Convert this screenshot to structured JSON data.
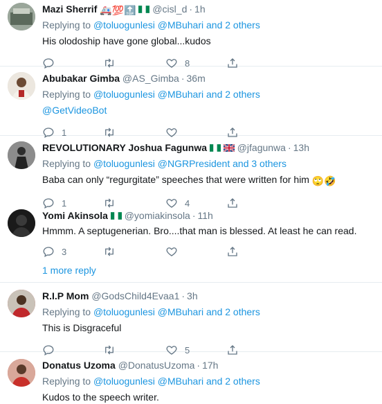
{
  "tweets": [
    {
      "name": "Mazi Sherrif",
      "handle": "@cisl_d",
      "time": "1h",
      "replying_prefix": "Replying to ",
      "mentions": "@toluogunlesi @MBuhari and 2 others",
      "text": "His olodoship have gone global...kudos",
      "reply_count": "",
      "retweet_count": "",
      "like_count": "8"
    },
    {
      "name": "Abubakar Gimba",
      "handle": "@AS_Gimba",
      "time": "36m",
      "replying_prefix": "Replying to ",
      "mentions": "@toluogunlesi @MBuhari and 2 others",
      "text": "@GetVideoBot",
      "reply_count": "1",
      "retweet_count": "",
      "like_count": ""
    },
    {
      "name": "REVOLUTIONARY Joshua Fagunwa",
      "handle": "@jfagunwa",
      "time": "13h",
      "replying_prefix": "Replying to ",
      "mentions": "@toluogunlesi @NGRPresident and 3 others",
      "text": "Baba can only “regurgitate” speeches that were written for him",
      "reply_count": "1",
      "retweet_count": "",
      "like_count": "4"
    },
    {
      "name": "Yomi Akinsola",
      "handle": "@yomiakinsola",
      "time": "11h",
      "replying_prefix": "",
      "mentions": "",
      "text": "Hmmm. A septugenerian. Bro....that man is blessed. At least he can read.",
      "reply_count": "3",
      "retweet_count": "",
      "like_count": ""
    },
    {
      "name": "R.I.P Mom",
      "handle": "@GodsChild4Evaa1",
      "time": "3h",
      "replying_prefix": "Replying to ",
      "mentions": "@toluogunlesi @MBuhari and 2 others",
      "text": "This is Disgraceful",
      "reply_count": "",
      "retweet_count": "",
      "like_count": "5"
    },
    {
      "name": "Donatus Uzoma",
      "handle": "@DonatusUzoma",
      "time": "17h",
      "replying_prefix": "Replying to ",
      "mentions": "@toluogunlesi @MBuhari and 2 others",
      "text": "Kudos to the speech writer.",
      "reply_count": "",
      "retweet_count": "",
      "like_count": ""
    }
  ],
  "more_replies_label": "1 more reply",
  "dot": "·",
  "emoji": {
    "hundred": "💯",
    "top": "🔝",
    "ambulance": "🚑",
    "rolling_eyes": "🙄",
    "rofl": "🤣"
  },
  "colors": {
    "link": "#1b95e0",
    "muted": "#657786",
    "text": "#14171a",
    "divider": "#e6ecf0"
  },
  "icons": [
    "reply-icon",
    "retweet-icon",
    "like-icon",
    "share-icon",
    "nigeria-flag-icon",
    "uk-flag-icon"
  ]
}
